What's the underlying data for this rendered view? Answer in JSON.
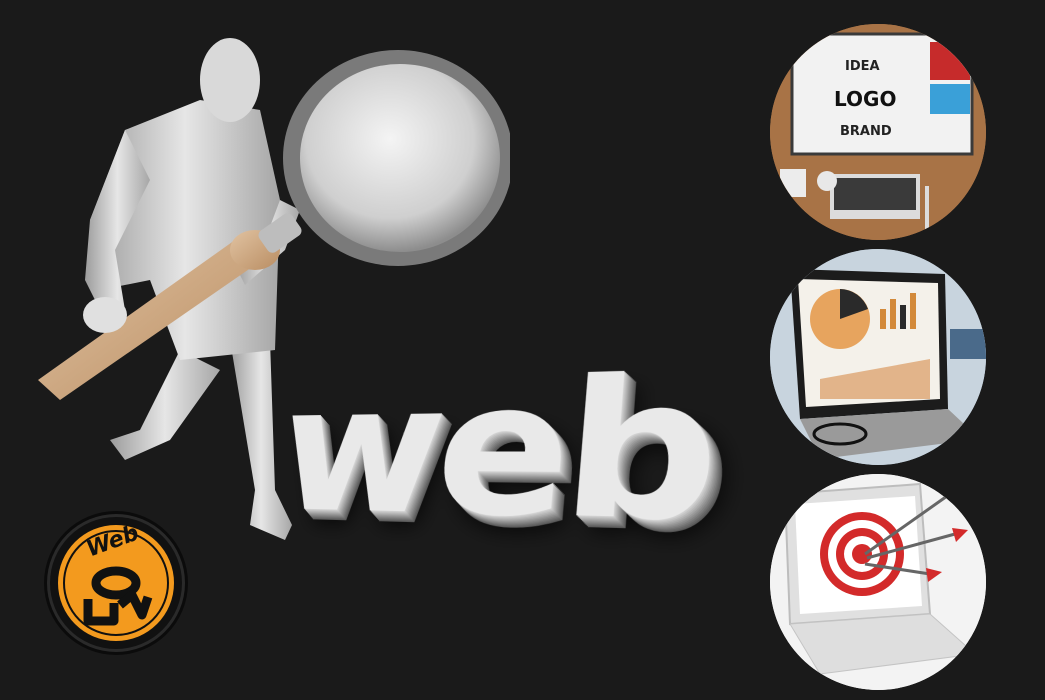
{
  "hero": {
    "word": "web"
  },
  "logo": {
    "text": "Web"
  },
  "circles": [
    {
      "name": "logo-design",
      "labels": {
        "top": "IDEA",
        "middle": "LOGO",
        "bottom": "BRAND"
      }
    },
    {
      "name": "analytics-laptop"
    },
    {
      "name": "target-laptop"
    }
  ],
  "colors": {
    "background": "#1a1a1a",
    "accent_orange": "#f39a1e",
    "target_red": "#d32a2a"
  }
}
